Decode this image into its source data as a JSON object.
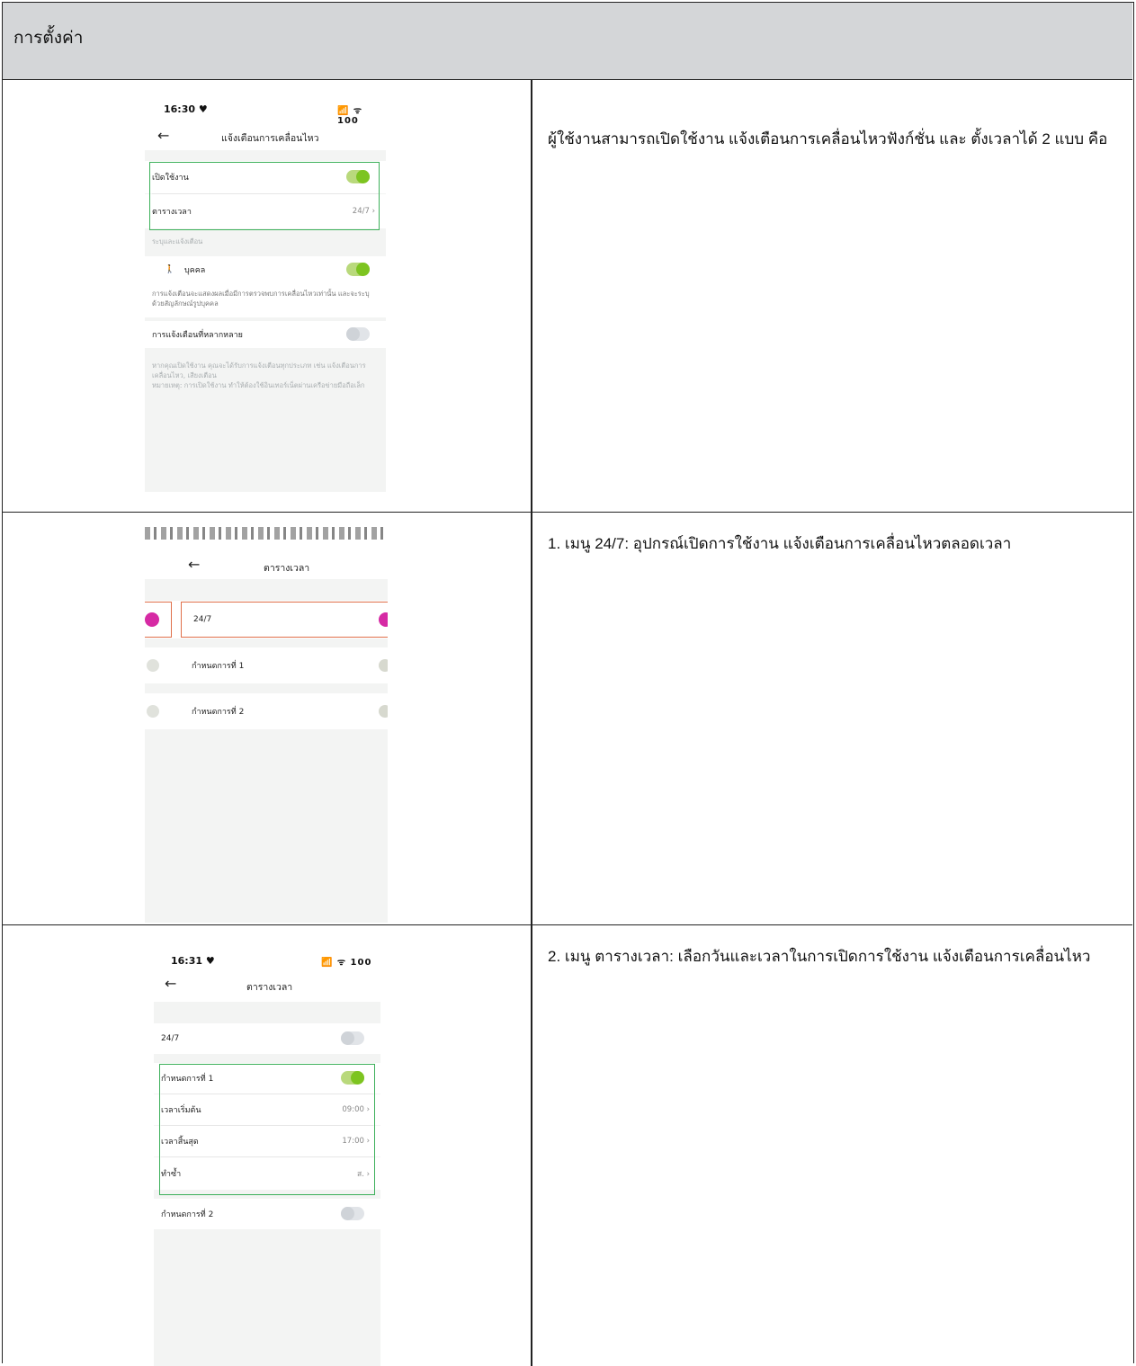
{
  "header": {
    "title": "การตั้งค่า"
  },
  "rows": [
    {
      "description": "ผู้ใช้งานสามารถเปิดใช้งาน แจ้งเตือนการเคลื่อนไหวฟังก์ชั่น และ ตั้งเวลาได้ 2 แบบ คือ",
      "phone": {
        "time": "16:30 ♥",
        "status_right": "📶 ᯤ 100",
        "title": "แจ้งเตือนการเคลื่อนไหว",
        "items": {
          "enable": "เปิดใช้งาน",
          "schedule": "ตารางเวลา",
          "schedule_value": "24/7",
          "section": "ระบุและแจ้งเตือน",
          "person": "บุคคล",
          "person_note": "การแจ้งเตือนจะแสดงผลเมื่อมีการตรวจพบการเคลื่อนไหวเท่านั้น และจะระบุ ด้วยสัญลักษณ์รูปบุคคล",
          "multi": "การแจ้งเตือนที่หลากหลาย",
          "multi_note_1": "หากคุณเปิดใช้งาน คุณจะได้รับการแจ้งเตือนทุกประเภท เช่น แจ้งเตือนการ",
          "multi_note_2": "เคลื่อนไหว, เสียงเตือน",
          "multi_note_3": "หมายเหตุ: การเปิดใช้งาน ทำให้ต้องใช้อินเทอร์เน็ตผ่านเครือข่ายมือถือเล็ก"
        }
      }
    },
    {
      "description": "1. เมนู 24/7: อุปกรณ์เปิดการใช้งาน แจ้งเตือนการเคลื่อนไหวตลอดเวลา",
      "phone": {
        "title": "ตารางเวลา",
        "items": {
          "always": "24/7",
          "plan1": "กำหนดการที่ 1",
          "plan2": "กำหนดการที่ 2"
        }
      }
    },
    {
      "description": "2. เมนู ตารางเวลา: เลือกวันและเวลาในการเปิดการใช้งาน แจ้งเตือนการเคลื่อนไหว",
      "phone": {
        "time": "16:31 ♥",
        "status_right": "📶 ᯤ 100",
        "title": "ตารางเวลา",
        "items": {
          "always": "24/7",
          "plan1": "กำหนดการที่ 1",
          "start": "เวลาเริ่มต้น",
          "start_value": "09:00",
          "end": "เวลาสิ้นสุด",
          "end_value": "17:00",
          "repeat": "ทำซ้ำ",
          "repeat_value": "ส.",
          "plan2": "กำหนดการที่ 2"
        }
      }
    }
  ]
}
